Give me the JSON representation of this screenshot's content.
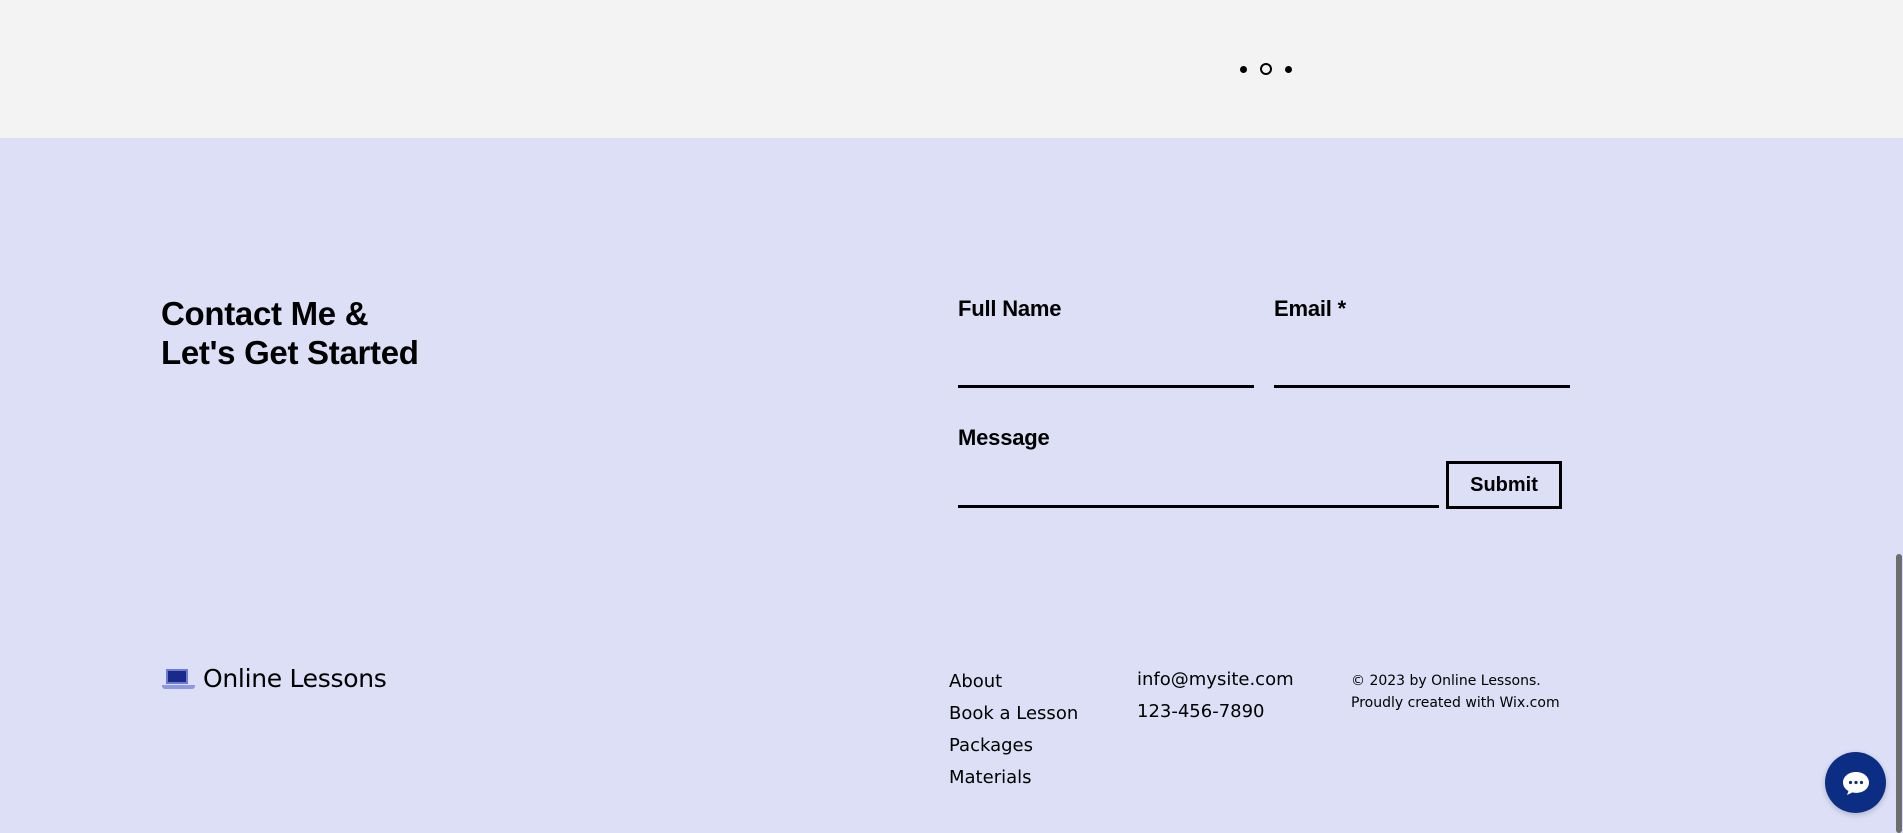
{
  "slideshow": {
    "dots": [
      "slide-1",
      "slide-2",
      "slide-3"
    ],
    "active_index": 1
  },
  "contact": {
    "title_line1": "Contact Me &",
    "title_line2": "Let's Get Started"
  },
  "form": {
    "full_name_label": "Full Name",
    "full_name_value": "",
    "email_label": "Email *",
    "email_value": "",
    "message_label": "Message",
    "message_value": "",
    "submit_label": "Submit"
  },
  "brand": {
    "icon": "laptop-icon",
    "name": "Online Lessons"
  },
  "footer": {
    "nav": [
      "About",
      "Book a Lesson",
      "Packages",
      "Materials"
    ],
    "email": "info@mysite.com",
    "phone": "123-456-7890",
    "copyright_line1": "© 2023 by Online Lessons.",
    "copyright_line2": "Proudly created with Wix.com"
  },
  "chat": {
    "icon": "chat-bubble-icon"
  },
  "colors": {
    "page_background": "#dcdff5",
    "top_band": "#f3f3f3",
    "chat_button": "#0c2d84",
    "laptop_screen": "#1b2a8a"
  }
}
